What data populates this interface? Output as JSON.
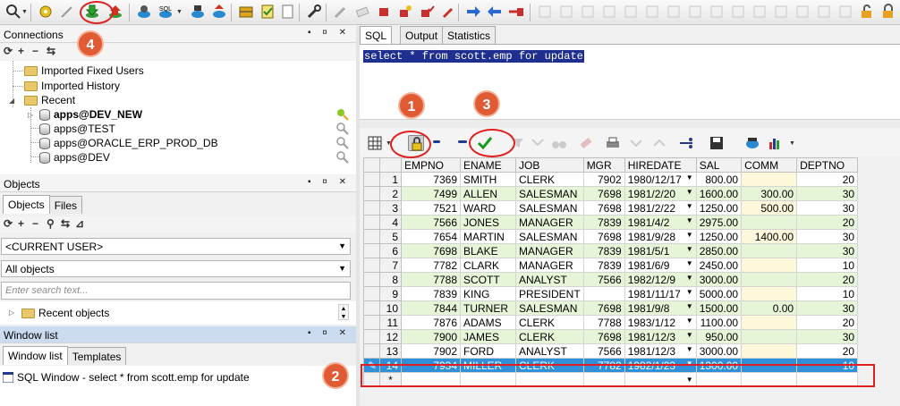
{
  "panes": {
    "connections": {
      "title": "Connections",
      "items": [
        "Imported Fixed Users",
        "Imported History",
        "Recent"
      ],
      "recent": [
        "apps@DEV_NEW",
        "apps@TEST",
        "apps@ORACLE_ERP_PROD_DB",
        "apps@DEV"
      ]
    },
    "objects": {
      "title": "Objects",
      "tabs": [
        "Objects",
        "Files"
      ],
      "user_combo": "<CURRENT USER>",
      "filter_combo": "All objects",
      "search_placeholder": "Enter search text...",
      "recent_objects": "Recent objects"
    },
    "window_list": {
      "title": "Window list",
      "tabs": [
        "Window list",
        "Templates"
      ],
      "items": [
        "SQL Window - select * from scott.emp for update"
      ]
    }
  },
  "editor": {
    "tabs": [
      "SQL",
      "Output",
      "Statistics"
    ],
    "sql": "select * from scott.emp for update"
  },
  "grid": {
    "columns": [
      "EMPNO",
      "ENAME",
      "JOB",
      "MGR",
      "HIREDATE",
      "SAL",
      "COMM",
      "DEPTNO"
    ],
    "rows": [
      {
        "n": "1",
        "empno": "7369",
        "ename": "SMITH",
        "job": "CLERK",
        "mgr": "7902",
        "hiredate": "1980/12/17",
        "sal": "800.00",
        "comm": "",
        "deptno": "20"
      },
      {
        "n": "2",
        "empno": "7499",
        "ename": "ALLEN",
        "job": "SALESMAN",
        "mgr": "7698",
        "hiredate": "1981/2/20",
        "sal": "1600.00",
        "comm": "300.00",
        "deptno": "30"
      },
      {
        "n": "3",
        "empno": "7521",
        "ename": "WARD",
        "job": "SALESMAN",
        "mgr": "7698",
        "hiredate": "1981/2/22",
        "sal": "1250.00",
        "comm": "500.00",
        "deptno": "30"
      },
      {
        "n": "4",
        "empno": "7566",
        "ename": "JONES",
        "job": "MANAGER",
        "mgr": "7839",
        "hiredate": "1981/4/2",
        "sal": "2975.00",
        "comm": "",
        "deptno": "20"
      },
      {
        "n": "5",
        "empno": "7654",
        "ename": "MARTIN",
        "job": "SALESMAN",
        "mgr": "7698",
        "hiredate": "1981/9/28",
        "sal": "1250.00",
        "comm": "1400.00",
        "deptno": "30"
      },
      {
        "n": "6",
        "empno": "7698",
        "ename": "BLAKE",
        "job": "MANAGER",
        "mgr": "7839",
        "hiredate": "1981/5/1",
        "sal": "2850.00",
        "comm": "",
        "deptno": "30"
      },
      {
        "n": "7",
        "empno": "7782",
        "ename": "CLARK",
        "job": "MANAGER",
        "mgr": "7839",
        "hiredate": "1981/6/9",
        "sal": "2450.00",
        "comm": "",
        "deptno": "10"
      },
      {
        "n": "8",
        "empno": "7788",
        "ename": "SCOTT",
        "job": "ANALYST",
        "mgr": "7566",
        "hiredate": "1982/12/9",
        "sal": "3000.00",
        "comm": "",
        "deptno": "20"
      },
      {
        "n": "9",
        "empno": "7839",
        "ename": "KING",
        "job": "PRESIDENT",
        "mgr": "",
        "hiredate": "1981/11/17",
        "sal": "5000.00",
        "comm": "",
        "deptno": "10"
      },
      {
        "n": "10",
        "empno": "7844",
        "ename": "TURNER",
        "job": "SALESMAN",
        "mgr": "7698",
        "hiredate": "1981/9/8",
        "sal": "1500.00",
        "comm": "0.00",
        "deptno": "30"
      },
      {
        "n": "11",
        "empno": "7876",
        "ename": "ADAMS",
        "job": "CLERK",
        "mgr": "7788",
        "hiredate": "1983/1/12",
        "sal": "1100.00",
        "comm": "",
        "deptno": "20"
      },
      {
        "n": "12",
        "empno": "7900",
        "ename": "JAMES",
        "job": "CLERK",
        "mgr": "7698",
        "hiredate": "1981/12/3",
        "sal": "950.00",
        "comm": "",
        "deptno": "30"
      },
      {
        "n": "13",
        "empno": "7902",
        "ename": "FORD",
        "job": "ANALYST",
        "mgr": "7566",
        "hiredate": "1981/12/3",
        "sal": "3000.00",
        "comm": "",
        "deptno": "20"
      },
      {
        "n": "14",
        "empno": "7934",
        "ename": "MILLER",
        "job": "CLERK",
        "mgr": "7782",
        "hiredate": "1982/1/23",
        "sal": "1300.00",
        "comm": "",
        "deptno": "10"
      }
    ],
    "new_row_marker": "*"
  },
  "callouts": [
    "1",
    "2",
    "3",
    "4"
  ],
  "colors": {
    "selection": "#2f8fd8",
    "callout": "#e05b33",
    "highlight": "#e02020",
    "row_alt": "#e6f5d8",
    "sql_highlight": "#1f2f8f"
  },
  "icons": {
    "toolbar": [
      "search-icon",
      "gear-icon",
      "wand-icon",
      "download-icon",
      "upload-icon",
      "db-sql-icon",
      "db-import-icon",
      "db-export-icon",
      "puzzle-icon",
      "notepad-icon",
      "document-icon",
      "wrench-icon"
    ],
    "grid_toolbar": [
      "grid-view-icon",
      "lock-icon",
      "add-record-icon",
      "delete-record-icon",
      "post-changes-icon",
      "filter-icon",
      "sort-icon",
      "binoculars-icon",
      "eraser-icon",
      "print-icon",
      "export-icon",
      "save-icon",
      "db-icon",
      "chart-icon"
    ]
  }
}
